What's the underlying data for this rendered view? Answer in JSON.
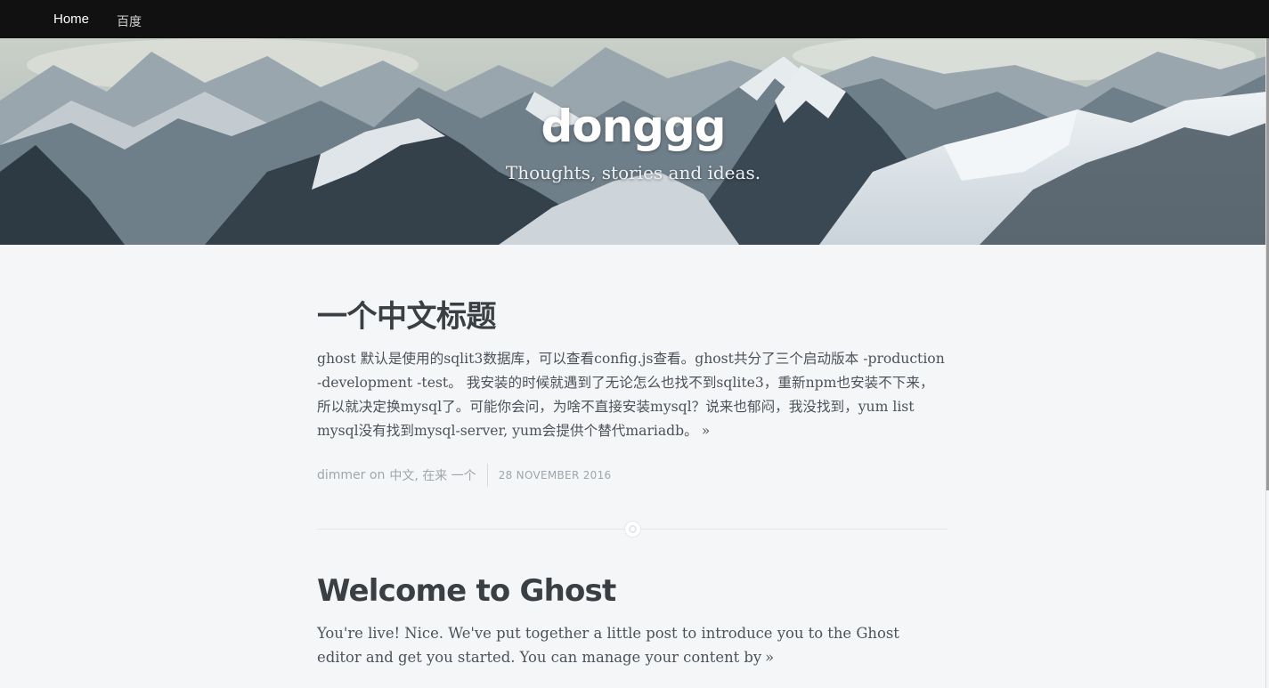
{
  "nav": {
    "home_label": "Home",
    "baidu_label": "百度"
  },
  "hero": {
    "title": "donggg",
    "description": "Thoughts, stories and ideas."
  },
  "posts": [
    {
      "title": "一个中文标题",
      "excerpt": "ghost 默认是使用的sqlit3数据库，可以查看config.js查看。ghost共分了三个启动版本 -production -development -test。 我安装的时候就遇到了无论怎么也找不到sqlite3，重新npm也安装不下来，所以就决定换mysql了。可能你会问，为啥不直接安装mysql？说来也郁闷，我没找到，yum list mysql没有找到mysql-server, yum会提供个替代mariadb。",
      "more": "»",
      "author": "dimmer",
      "on": "on",
      "tags": "中文, 在来 一个",
      "date": "28 November 2016"
    },
    {
      "title": "Welcome to Ghost",
      "excerpt": "You're live! Nice. We've put together a little post to introduce you to the Ghost editor and get you started. You can manage your content by",
      "more": "»"
    }
  ],
  "colors": {
    "navbar": "#111111",
    "page_bg": "#f5f6f8",
    "title_text": "#3a3f43",
    "meta_text": "#9ea6ac"
  },
  "icons": [
    "mountain-banner-image",
    "divider-circle-icon"
  ]
}
